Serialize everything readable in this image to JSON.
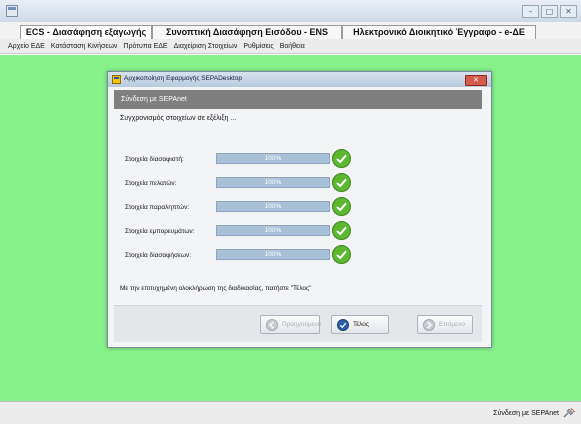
{
  "window": {
    "tabs": [
      {
        "label": "ECS - Διασάφηση εξαγωγής",
        "active": true
      },
      {
        "label": "Συνοπτική Διασάφηση Εισόδου - ENS",
        "active": false
      },
      {
        "label": "Ηλεκτρονικό Διοικητικό Έγγραφο - e-ΔΕ",
        "active": false
      }
    ]
  },
  "menu": {
    "items": [
      "Αρχείο ΕΔΕ",
      "Κατάσταση Κινήσεων",
      "Πρότυπα ΕΔΕ",
      "Διαχείριση Στοιχείων",
      "Ρυθμίσεις",
      "Βοήθεια"
    ]
  },
  "dialog": {
    "title": "Αρχικοποίηση Εφαρμογής SEPADesktop",
    "header": "Σύνδεση με SEPAnet",
    "sync_status": "Συγχρονισμός στοιχείων σε εξέλιξη ...",
    "rows": [
      {
        "label": "Στοιχεία διασαφιστή:",
        "progress_text": "100%",
        "progress": 1.0
      },
      {
        "label": "Στοιχεία πελατών:",
        "progress_text": "100%",
        "progress": 1.0
      },
      {
        "label": "Στοιχεία παραληπτών:",
        "progress_text": "100%",
        "progress": 1.0
      },
      {
        "label": "Στοιχεία εμπορευμάτων:",
        "progress_text": "100%",
        "progress": 1.0
      },
      {
        "label": "Στοιχεία διασαφήσεων:",
        "progress_text": "100%",
        "progress": 1.0
      }
    ],
    "finish_note": "Με την επιτυχημένη ολοκλήρωση της διαδικασίας, πατήστε \"Τέλος\"",
    "buttons": {
      "previous": "Προηγούμενο",
      "finish": "Τέλος",
      "next": "Επόμενο"
    }
  },
  "statusbar": {
    "connection_text": "Σύνδεση με SEPAnet"
  },
  "colors": {
    "workspace": "#88f28a",
    "check": "#5cb830",
    "progress": "#b7cbe0",
    "header": "#7f7f7f"
  },
  "icons": {
    "app": "app-icon",
    "check": "check-circle-icon",
    "status": "connection-plug-icon"
  }
}
